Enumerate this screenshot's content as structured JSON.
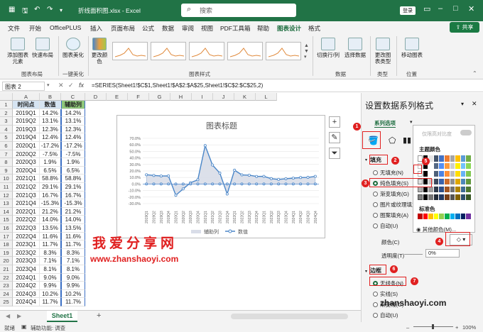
{
  "titlebar": {
    "doc_name": "折线面积图.xlsx - Excel",
    "search_placeholder": "搜索",
    "login": "登录"
  },
  "menu": {
    "tabs": [
      "文件",
      "开始",
      "OfficePLUS",
      "插入",
      "页面布局",
      "公式",
      "数据",
      "审阅",
      "视图",
      "PDF工具箱",
      "帮助",
      "图表设计",
      "格式"
    ],
    "active": "图表设计",
    "share": "共享"
  },
  "ribbon": {
    "buttons": [
      "添加图表元素",
      "快速布局",
      "图表美化",
      "更改颜色",
      "切换行/列",
      "选择数据",
      "更改图表类型",
      "移动图表"
    ],
    "groups": [
      "图表布局",
      "一键美化",
      "图表样式",
      "数据",
      "类型",
      "位置"
    ]
  },
  "formula_bar": {
    "name_box": "图表 2",
    "fx": "fx",
    "formula": "=SERIES(Sheet1!$C$1,Sheet1!$A$2:$A$25,Sheet1!$C$2:$C$25,2)"
  },
  "columns": [
    "A",
    "B",
    "C",
    "D",
    "E",
    "F",
    "G",
    "H",
    "I",
    "J",
    "K",
    "L"
  ],
  "table": {
    "headers": [
      "时间点",
      "数值",
      "辅助列"
    ],
    "rows": [
      [
        "2019Q1",
        "14.2%",
        "14.2%"
      ],
      [
        "2019Q2",
        "13.1%",
        "13.1%"
      ],
      [
        "2019Q3",
        "12.3%",
        "12.3%"
      ],
      [
        "2019Q4",
        "12.4%",
        "12.4%"
      ],
      [
        "2020Q1",
        "-17.2%",
        "-17.2%"
      ],
      [
        "2020Q2",
        "-7.5%",
        "-7.5%"
      ],
      [
        "2020Q3",
        "1.9%",
        "1.9%"
      ],
      [
        "2020Q4",
        "6.5%",
        "6.5%"
      ],
      [
        "2021Q1",
        "58.8%",
        "58.8%"
      ],
      [
        "2021Q2",
        "29.1%",
        "29.1%"
      ],
      [
        "2021Q3",
        "16.7%",
        "16.7%"
      ],
      [
        "2021Q4",
        "-15.3%",
        "-15.3%"
      ],
      [
        "2022Q1",
        "21.2%",
        "21.2%"
      ],
      [
        "2022Q2",
        "14.0%",
        "14.0%"
      ],
      [
        "2022Q3",
        "13.5%",
        "13.5%"
      ],
      [
        "2022Q4",
        "11.6%",
        "11.6%"
      ],
      [
        "2023Q1",
        "11.7%",
        "11.7%"
      ],
      [
        "2023Q2",
        "8.3%",
        "8.3%"
      ],
      [
        "2023Q3",
        "7.1%",
        "7.1%"
      ],
      [
        "2023Q4",
        "8.1%",
        "8.1%"
      ],
      [
        "2024Q1",
        "9.0%",
        "9.0%"
      ],
      [
        "2024Q2",
        "9.9%",
        "9.9%"
      ],
      [
        "2024Q3",
        "10.2%",
        "10.2%"
      ],
      [
        "2024Q4",
        "11.7%",
        "11.7%"
      ]
    ]
  },
  "chart_data": {
    "type": "line",
    "title": "图表标题",
    "categories": [
      "2019Q1",
      "2019Q2",
      "2019Q3",
      "2019Q4",
      "2020Q1",
      "2020Q2",
      "2020Q3",
      "2020Q4",
      "2021Q1",
      "2021Q2",
      "2021Q3",
      "2021Q4",
      "2022Q1",
      "2022Q2",
      "2022Q3",
      "2022Q4",
      "2023Q1",
      "2023Q2",
      "2023Q3",
      "2023Q4",
      "2024Q1",
      "2024Q2",
      "2024Q3",
      "2024Q4"
    ],
    "series": [
      {
        "name": "辅助列",
        "kind": "area",
        "color": "#d9dde8",
        "values": [
          14.2,
          13.1,
          12.3,
          12.4,
          -17.2,
          -7.5,
          1.9,
          6.5,
          58.8,
          29.1,
          16.7,
          -15.3,
          21.2,
          14.0,
          13.5,
          11.6,
          11.7,
          8.3,
          7.1,
          8.1,
          9.0,
          9.9,
          10.2,
          11.7
        ]
      },
      {
        "name": "数值",
        "kind": "line",
        "color": "#4a86c8",
        "values": [
          14.2,
          13.1,
          12.3,
          12.4,
          -17.2,
          -7.5,
          1.9,
          6.5,
          58.8,
          29.1,
          16.7,
          -15.3,
          21.2,
          14.0,
          13.5,
          11.6,
          11.7,
          8.3,
          7.1,
          8.1,
          9.0,
          9.9,
          10.2,
          11.7
        ]
      }
    ],
    "y_ticks": [
      "70.0%",
      "60.0%",
      "50.0%",
      "40.0%",
      "30.0%",
      "20.0%",
      "10.0%",
      "0.0%",
      "-10.0%",
      "-20.0%",
      "-30.0%"
    ],
    "ylim": [
      -30,
      70
    ],
    "legend": "bottom"
  },
  "watermark": {
    "text": "我爱分享网",
    "url": "www.zhanshaoyi.com",
    "corner": "zhanshaoyi.com"
  },
  "sheet": {
    "tab": "Sheet1"
  },
  "status": {
    "ready": "就绪",
    "accessibility": "辅助功能: 调查",
    "zoom": "100%"
  },
  "pane": {
    "title": "设置数据系列格式",
    "sub_tab": "系列选项",
    "fill_section": "填充",
    "fill_options": [
      "无填充(N)",
      "纯色填充(S)",
      "渐变填充(G)",
      "图片或纹理填充",
      "图案填充(A)",
      "自动(U)"
    ],
    "color_label": "颜色(C)",
    "transparency_label": "透明度(T)",
    "transparency_value": "0%",
    "border_section": "边框",
    "border_options": [
      "无线条(N)",
      "实线(S)",
      "渐变线(G)",
      "自动(U)"
    ],
    "palette": {
      "recent": "仅限高对比度",
      "theme": "主题颜色",
      "standard": "标准色",
      "more": "其他颜色(M)..."
    },
    "badges": [
      "1",
      "2",
      "3",
      "4",
      "5",
      "6",
      "7"
    ]
  }
}
